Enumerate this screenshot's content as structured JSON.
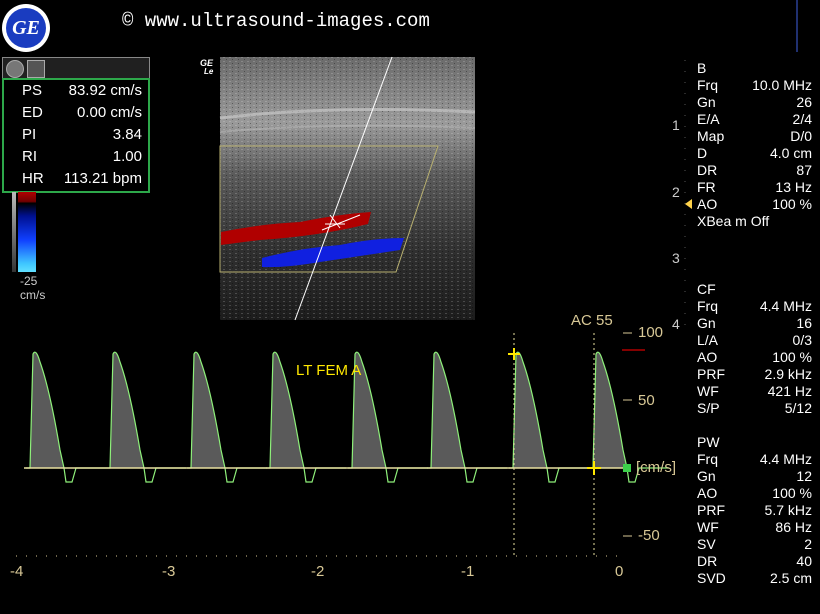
{
  "header": {
    "copyright": "© www.ultrasound-images.com",
    "logo_text": "GE"
  },
  "bmode": {
    "tag_top": "GE",
    "tag_bottom": "Le"
  },
  "measurements": [
    {
      "key": "PS",
      "value": "83.92 cm/s"
    },
    {
      "key": "ED",
      "value": "0.00 cm/s"
    },
    {
      "key": "PI",
      "value": "3.84"
    },
    {
      "key": "RI",
      "value": "1.00"
    },
    {
      "key": "HR",
      "value": "113.21 bpm"
    }
  ],
  "colorbar": {
    "min": "-25",
    "unit": "cm/s"
  },
  "depth_markers": [
    "1",
    "2",
    "3",
    "4"
  ],
  "settings_b": {
    "title": "B",
    "rows": [
      {
        "k": "Frq",
        "v": "10.0 MHz"
      },
      {
        "k": "Gn",
        "v": "26"
      },
      {
        "k": "E/A",
        "v": "2/4"
      },
      {
        "k": "Map",
        "v": "D/0"
      },
      {
        "k": "D",
        "v": "4.0 cm"
      },
      {
        "k": "DR",
        "v": "87"
      },
      {
        "k": "FR",
        "v": "13 Hz"
      },
      {
        "k": "AO",
        "v": "100 %"
      },
      {
        "k": "XBea m Off",
        "v": ""
      }
    ]
  },
  "settings_cf": {
    "title": "CF",
    "rows": [
      {
        "k": "Frq",
        "v": "4.4 MHz"
      },
      {
        "k": "Gn",
        "v": "16"
      },
      {
        "k": "L/A",
        "v": "0/3"
      },
      {
        "k": "AO",
        "v": "100 %"
      },
      {
        "k": "PRF",
        "v": "2.9 kHz"
      },
      {
        "k": "WF",
        "v": "421 Hz"
      },
      {
        "k": "S/P",
        "v": "5/12"
      }
    ]
  },
  "settings_pw": {
    "title": "PW",
    "rows": [
      {
        "k": "Frq",
        "v": "4.4 MHz"
      },
      {
        "k": "Gn",
        "v": "12"
      },
      {
        "k": "AO",
        "v": "100 %"
      },
      {
        "k": "PRF",
        "v": "5.7 kHz"
      },
      {
        "k": "WF",
        "v": "86 Hz"
      },
      {
        "k": "SV",
        "v": "2"
      },
      {
        "k": "DR",
        "v": "40"
      },
      {
        "k": "SVD",
        "v": "2.5 cm"
      }
    ]
  },
  "doppler": {
    "vessel_label": "LT FEM A",
    "ac_label": "AC 55",
    "velocity_ticks": [
      "100",
      "50",
      "-50"
    ],
    "unit_label": "[cm/s]",
    "time_ticks": [
      "-4",
      "-3",
      "-2",
      "-1",
      "0"
    ]
  },
  "colors": {
    "waveform_outline": "#8ef07a",
    "baseline": "#e8e0a0",
    "text_scale": "#d8c896",
    "flow_red": "#b00000",
    "flow_blue": "#1020e0"
  }
}
